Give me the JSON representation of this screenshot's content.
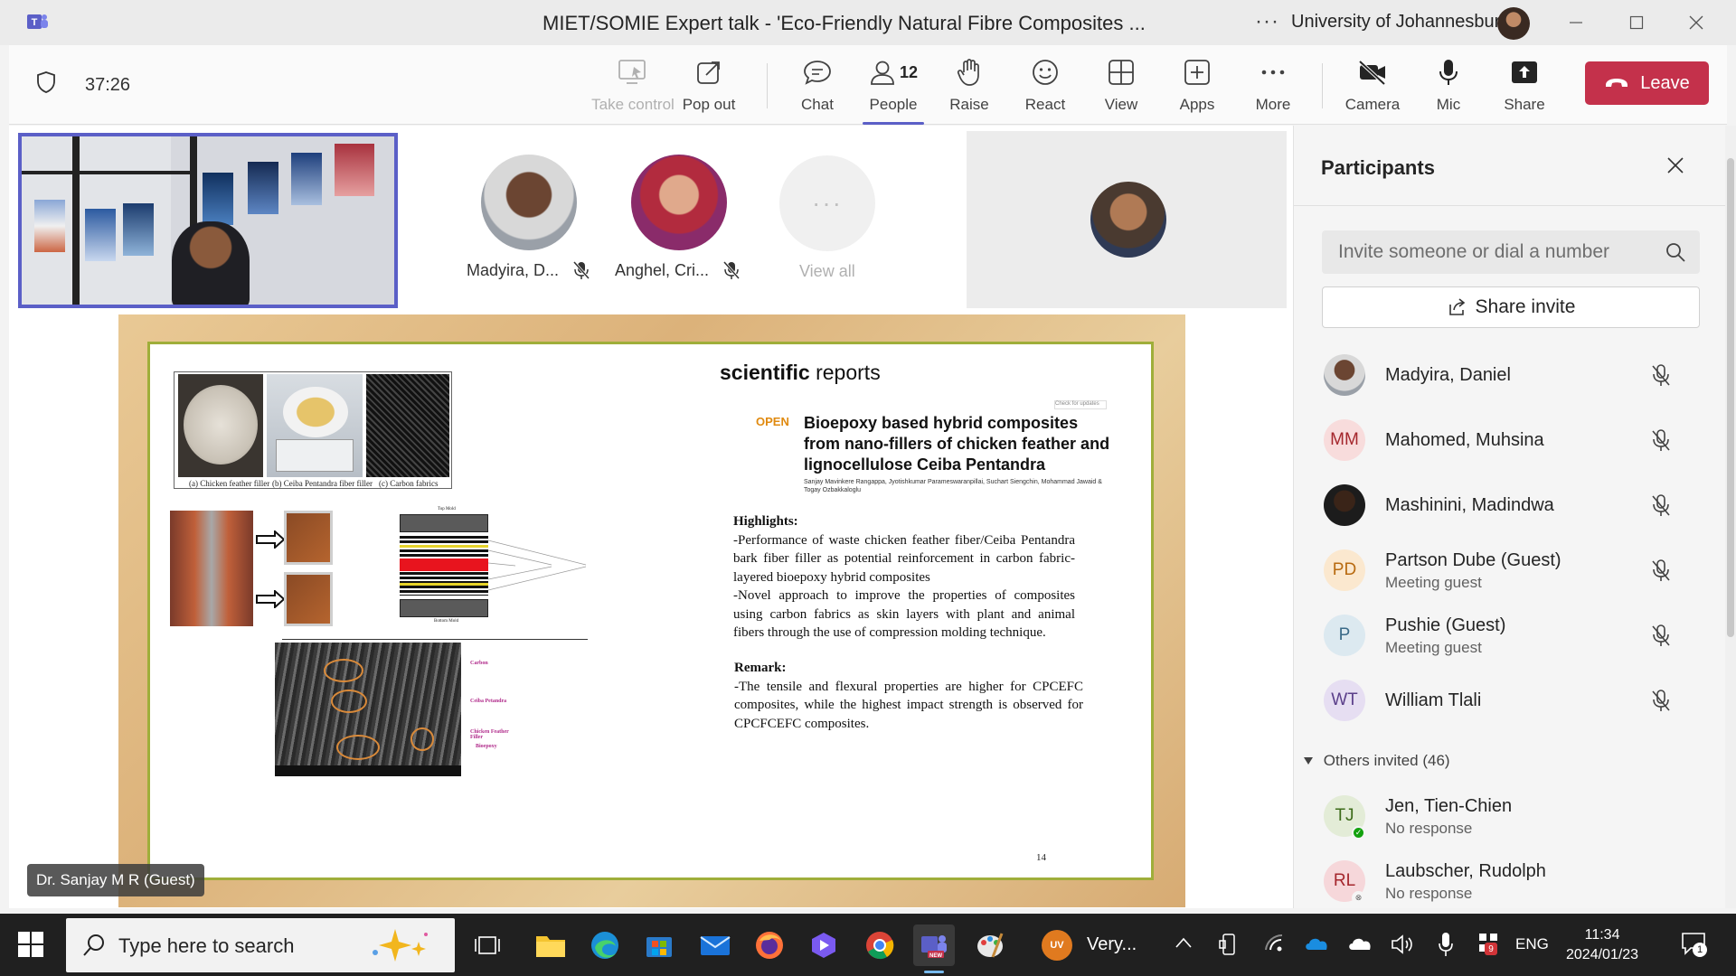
{
  "window": {
    "title": "MIET/SOMIE Expert talk - 'Eco-Friendly Natural Fibre Composites ...",
    "organization": "University of Johannesburg",
    "more_label": "···"
  },
  "toolbar": {
    "timer": "37:26",
    "take_control": "Take control",
    "pop_out": "Pop out",
    "chat": "Chat",
    "people": "People",
    "people_count": "12",
    "raise": "Raise",
    "react": "React",
    "view": "View",
    "apps": "Apps",
    "more": "More",
    "camera": "Camera",
    "mic": "Mic",
    "share": "Share",
    "leave": "Leave",
    "accent_color": "#5b5fc7",
    "leave_color": "#c4314b"
  },
  "stage": {
    "participants": [
      {
        "name": "Madyira, D..."
      },
      {
        "name": "Anghel, Cri..."
      }
    ],
    "view_all": "View all",
    "speaker_label": "Dr. Sanjay M R (Guest)"
  },
  "slide": {
    "journal_bold": "scientific",
    "journal_rest": " reports",
    "open_tag": "OPEN",
    "check_updates": "Check for updates",
    "paper_title": "Bioepoxy based hybrid composites from nano-fillers of chicken feather and lignocellulose Ceiba Pentandra",
    "authors": "Sanjay Mavinkere Rangappa, Jyotishkumar Parameswaranpillai, Suchart Siengchin, Mohammad Jawaid & Togay Ozbakkaloglu",
    "captions": [
      "(a) Chicken feather filler",
      "(b) Ceiba Pentandra fiber filler",
      "(c) Carbon fabrics"
    ],
    "highlights_heading": "Highlights:",
    "highlights_text": "-Performance of waste chicken feather fiber/Ceiba Pentandra bark fiber filler as potential reinforcement in carbon fabric-layered bioepoxy hybrid composites\n-Novel approach to improve the properties of composites using carbon fabrics as skin layers with plant and animal fibers through the use of compression molding technique.",
    "remark_heading": "Remark:",
    "remark_text": "-The tensile and flexural properties are higher for CPCEFC composites, while the highest impact strength is observed for CPCFCEFC composites.",
    "page_number": "14",
    "sem_labels": [
      "Carbon",
      "Ceiba Petandra",
      "Chicken Feather Filler",
      "Bioepoxy"
    ],
    "mold_labels": [
      "Top Mold",
      "Bottom Mold"
    ]
  },
  "panel": {
    "title": "Participants",
    "search_placeholder": "Invite someone or dial a number",
    "share_invite": "Share invite",
    "rows": [
      {
        "name": "Madyira, Daniel",
        "initials": "",
        "sub": ""
      },
      {
        "name": "Mahomed, Muhsina",
        "initials": "MM",
        "sub": ""
      },
      {
        "name": "Mashinini, Madindwa",
        "initials": "",
        "sub": ""
      },
      {
        "name": "Partson Dube (Guest)",
        "initials": "PD",
        "sub": "Meeting guest"
      },
      {
        "name": "Pushie (Guest)",
        "initials": "P",
        "sub": "Meeting guest"
      },
      {
        "name": "William Tlali",
        "initials": "WT",
        "sub": ""
      }
    ],
    "others_invited": "Others invited (46)",
    "invited": [
      {
        "name": "Jen, Tien-Chien",
        "initials": "TJ",
        "sub": "No response"
      },
      {
        "name": "Laubscher, Rudolph",
        "initials": "RL",
        "sub": "No response"
      }
    ]
  },
  "taskbar": {
    "search_placeholder": "Type here to search",
    "weather_badge": "UV",
    "weather_text": "Very...",
    "language": "ENG",
    "time": "11:34",
    "date": "2024/01/23",
    "notifications": "1",
    "battery_badge": "9"
  }
}
